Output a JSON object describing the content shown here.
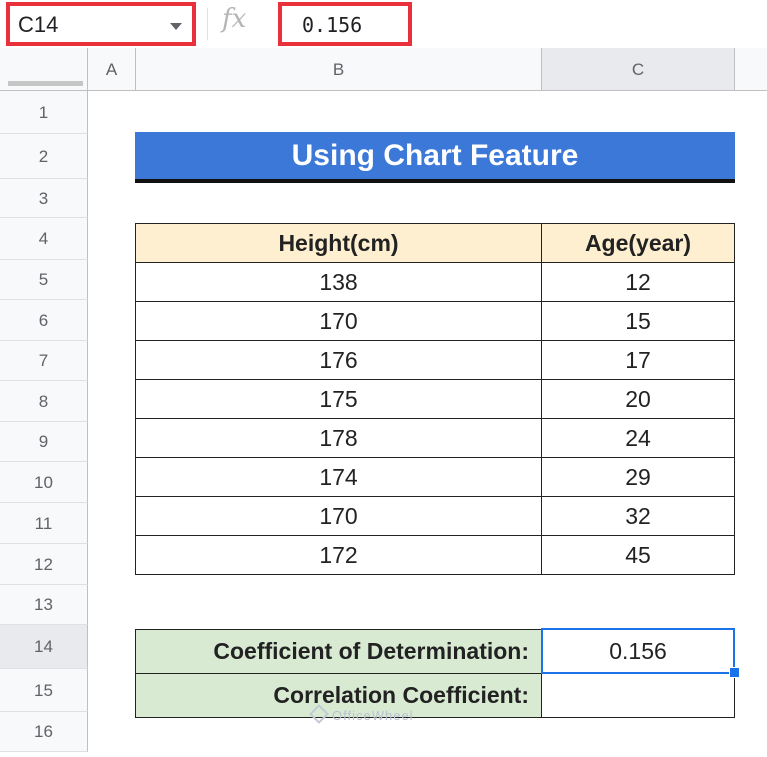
{
  "formula_bar": {
    "name_box": "C14",
    "fx_label": "fx",
    "formula_value": "0.156"
  },
  "columns": [
    "A",
    "B",
    "C"
  ],
  "rows": [
    "1",
    "2",
    "3",
    "4",
    "5",
    "6",
    "7",
    "8",
    "9",
    "10",
    "11",
    "12",
    "13",
    "14",
    "15",
    "16"
  ],
  "title": "Using Chart Feature",
  "table": {
    "headers": [
      "Height(cm)",
      "Age(year)"
    ],
    "rows": [
      [
        "138",
        "12"
      ],
      [
        "170",
        "15"
      ],
      [
        "176",
        "17"
      ],
      [
        "175",
        "20"
      ],
      [
        "178",
        "24"
      ],
      [
        "174",
        "29"
      ],
      [
        "170",
        "32"
      ],
      [
        "172",
        "45"
      ]
    ]
  },
  "results": {
    "coef_determination_label": "Coefficient of Determination:",
    "coef_determination_value": "0.156",
    "correlation_label": "Correlation Coefficient:",
    "correlation_value": ""
  },
  "watermark": "OfficeWheel",
  "colors": {
    "title_bg": "#3c78d8",
    "header_bg": "#fdefd0",
    "label_bg": "#d9ead3",
    "highlight": "#e8313a",
    "selection": "#1a73e8"
  }
}
